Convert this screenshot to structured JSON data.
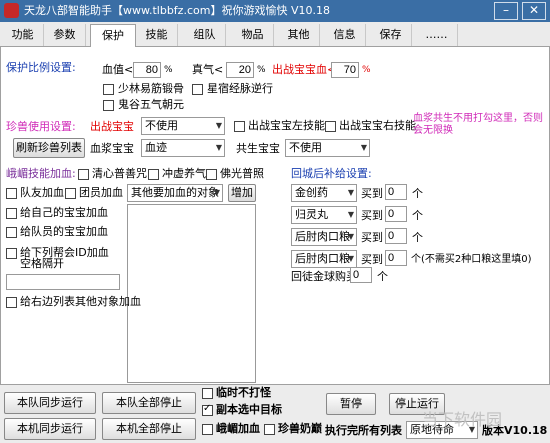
{
  "window": {
    "title": "天龙八部智能助手【www.tlbbfz.com】祝你游戏愉快 V10.18",
    "min": "–",
    "close": "✕"
  },
  "tabs": [
    "功能",
    "参数",
    "保护",
    "技能",
    "组队",
    "物品",
    "其他",
    "信息",
    "保存",
    "……"
  ],
  "protect": {
    "heading": "保护比例设置:",
    "hp_label": "血值<",
    "hp_value": "80",
    "hp_unit": "%",
    "mp_label": "真气<",
    "mp_value": "20",
    "mp_unit": "%",
    "pet_hp_label": "出战宝宝血<",
    "pet_hp_value": "70",
    "pet_hp_unit": "%",
    "cb1": "少林易筋锻骨",
    "cb2": "星宿经脉逆行",
    "cb3": "鬼谷五气朝元"
  },
  "pet": {
    "heading": "珍兽使用设置:",
    "battle_label": "出战宝宝",
    "battle_value": "不使用",
    "left_skill": "出战宝宝左技能",
    "right_skill": "出战宝宝右技能",
    "note": "血浆共生不用打勾这里，否则会无限换",
    "refresh_btn": "刷新珍兽列表",
    "blood_label": "血浆宝宝",
    "blood_value": "血迹",
    "symbiote_label": "共生宝宝",
    "symbiote_value": "不使用"
  },
  "emei": {
    "heading": "峨嵋技能加血:",
    "s1": "清心普善咒",
    "s2": "冲虚养气",
    "s3": "佛光普照",
    "team": "队友加血",
    "group": "团员加血",
    "target_value": "其他要加血的对象",
    "add_btn": "增加",
    "own_pet": "给自己的宝宝加血",
    "team_pet": "给队员的宝宝加血",
    "guild": "给下列帮会ID加血",
    "guild_sub": "空格隔开",
    "right_list": "给右边列表其他对象加血"
  },
  "supply": {
    "heading": "回城后补给设置:",
    "buy": "买到",
    "unit": "个",
    "rows": [
      {
        "item": "金创药",
        "count": "0"
      },
      {
        "item": "归灵丸",
        "count": "0"
      },
      {
        "item": "后肘肉口粮",
        "count": "0"
      },
      {
        "item": "后肘肉口粮",
        "count": "0",
        "note": "个(不需买2种口粮这里填0)"
      }
    ],
    "gold_label": "回徒金球购买",
    "gold_count": "0"
  },
  "bottom": {
    "team_sync": "本队同步运行",
    "team_stop": "本队全部停止",
    "local_sync": "本机同步运行",
    "local_stop": "本机全部停止",
    "cb_nofight": "临时不打怪",
    "cb_dungeon": "副本选中目标",
    "cb_emei": "峨嵋加血",
    "cb_pet": "珍兽奶巅",
    "pause": "暂停",
    "stop": "停止运行",
    "run_list": "执行完所有列表",
    "wait_value": "原地待命",
    "version": "版本V10.18"
  },
  "watermark": "当下软件园"
}
